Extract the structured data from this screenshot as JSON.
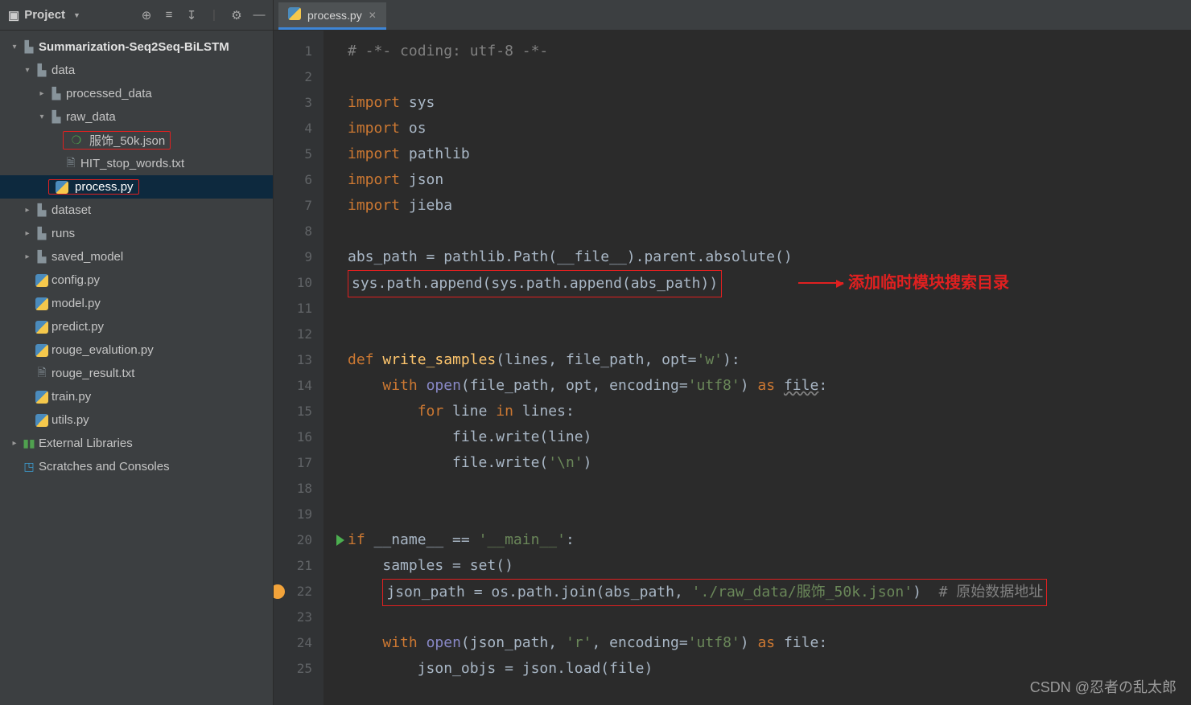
{
  "sidebar": {
    "project_label": "Project",
    "tree": {
      "root": "Summarization-Seq2Seq-BiLSTM",
      "data": "data",
      "processed_data": "processed_data",
      "raw_data": "raw_data",
      "fushi_json": "服饰_50k.json",
      "hit_stop": "HIT_stop_words.txt",
      "process_py": "process.py",
      "dataset": "dataset",
      "runs": "runs",
      "saved_model": "saved_model",
      "config_py": "config.py",
      "model_py": "model.py",
      "predict_py": "predict.py",
      "rouge_eval_py": "rouge_evalution.py",
      "rouge_result_txt": "rouge_result.txt",
      "train_py": "train.py",
      "utils_py": "utils.py",
      "ext_lib": "External Libraries",
      "scratches": "Scratches and Consoles"
    }
  },
  "tab": {
    "name": "process.py"
  },
  "code": {
    "l1_comment": "# -*- coding: utf-8 -*-",
    "kw_import": "import",
    "kw_def": "def",
    "kw_with": "with",
    "kw_for": "for",
    "kw_in": "in",
    "kw_if": "if",
    "kw_as": "as",
    "mod_sys": "sys",
    "mod_os": "os",
    "mod_pathlib": "pathlib",
    "mod_json": "json",
    "mod_jieba": "jieba",
    "l9": "abs_path = pathlib.Path(__file__).parent.absolute()",
    "l10": "sys.path.append(sys.path.append(abs_path))",
    "l13_def": "write_samples",
    "l13_params": "(lines, file_path, opt=",
    "l13_str": "'w'",
    "l13_end": "):",
    "l14_a": "open(file_path, opt, ",
    "l14_enc": "encoding",
    "l14_b": "=",
    "l14_str": "'utf8'",
    "l14_c": ") ",
    "l14_file": "file",
    "l15_a": " line ",
    "l15_b": " lines:",
    "l16": "file.write(line)",
    "l17_a": "file.write(",
    "l17_str": "'\\n'",
    "l17_b": ")",
    "l20_a": " __name__ == ",
    "l20_str": "'__main__'",
    "l20_b": ":",
    "l21": "samples = set()",
    "l22_a": "json_path = os.path.join(abs_path, ",
    "l22_str": "'./raw_data/服饰_50k.json'",
    "l22_b": ")  ",
    "l22_com": "# 原始数据地址",
    "l24_a": "open(json_path, ",
    "l24_r": "'r'",
    "l24_b": ", ",
    "l24_str": "'utf8'",
    "l24_c": ") ",
    "l25": "json_objs = json.load(file)"
  },
  "annot": {
    "text": "添加临时模块搜索目录"
  },
  "watermark": "CSDN @忍者の乱太郎"
}
